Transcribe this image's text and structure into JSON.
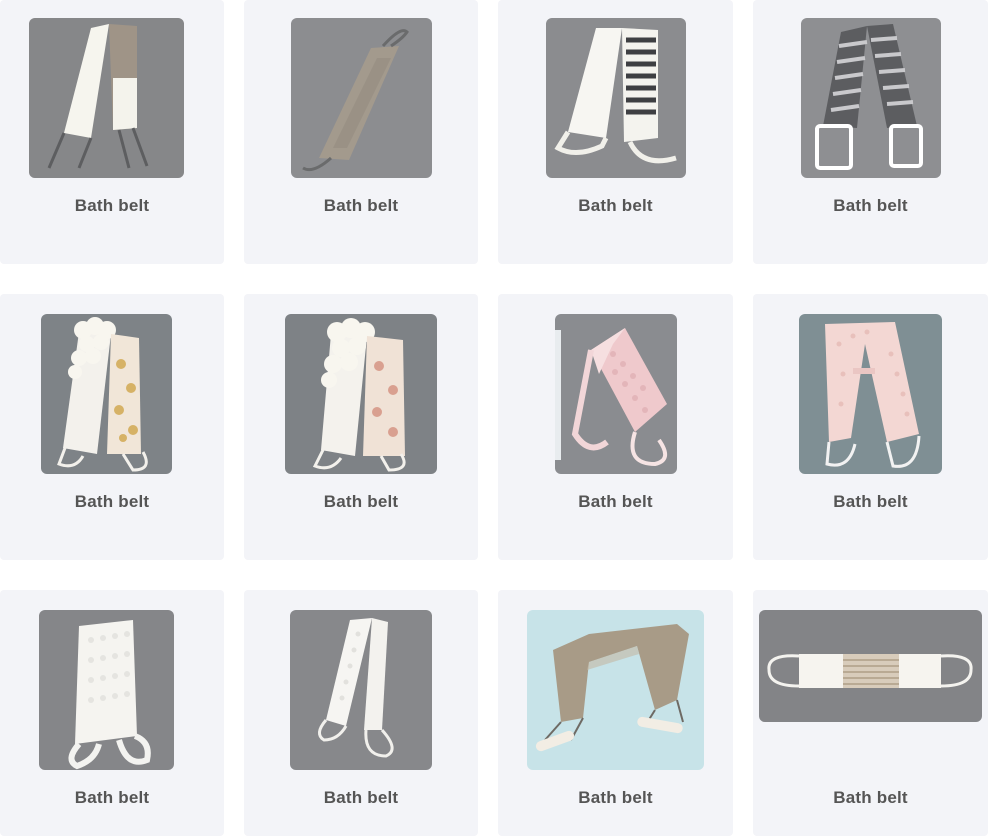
{
  "products": [
    {
      "name": "Bath belt",
      "image": "bath-belt-linen-white-icon"
    },
    {
      "name": "Bath belt",
      "image": "bath-belt-grey-linen-icon"
    },
    {
      "name": "Bath belt",
      "image": "bath-belt-striped-white-icon"
    },
    {
      "name": "Bath belt",
      "image": "bath-belt-striped-grey-handles-icon"
    },
    {
      "name": "Bath belt",
      "image": "bath-belt-ruffle-floral-icon"
    },
    {
      "name": "Bath belt",
      "image": "bath-belt-ruffle-floral-wide-icon"
    },
    {
      "name": "Bath belt",
      "image": "bath-belt-pink-quilted-icon"
    },
    {
      "name": "Bath belt",
      "image": "bath-belt-pink-long-icon"
    },
    {
      "name": "Bath belt",
      "image": "bath-belt-white-quilted-icon"
    },
    {
      "name": "Bath belt",
      "image": "bath-belt-white-narrow-icon"
    },
    {
      "name": "Bath belt",
      "image": "bath-belt-jute-wooden-handles-icon"
    },
    {
      "name": "Bath belt",
      "image": "bath-belt-horizontal-icon"
    }
  ]
}
